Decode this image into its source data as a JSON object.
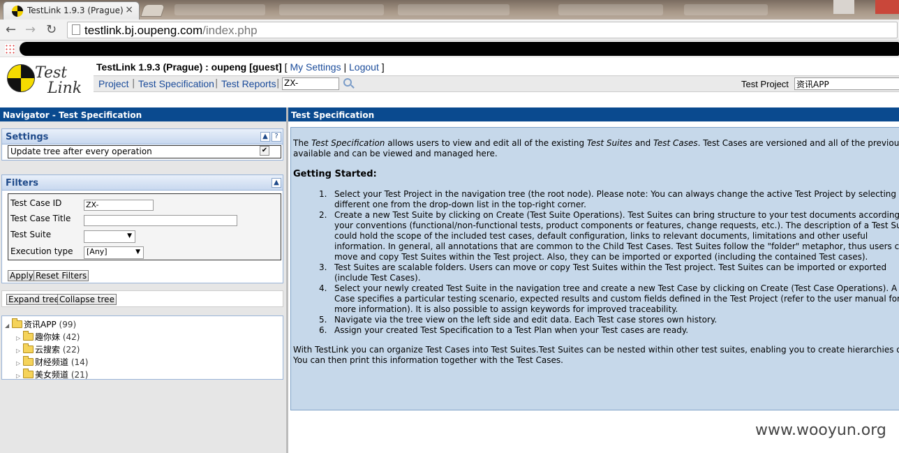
{
  "browser": {
    "tab_title": "TestLink 1.9.3 (Prague)",
    "tab_close": "×",
    "url_host": "testlink.bj.oupeng.com",
    "url_path": "/index.php"
  },
  "header": {
    "logo_text_1": "Test",
    "logo_text_2": "Link",
    "title": "TestLink 1.9.3 (Prague) : oupeng [guest]",
    "bracket_open": " [ ",
    "my_settings": "My Settings",
    "pipe": " | ",
    "logout": "Logout",
    "bracket_close": " ]",
    "menu": {
      "project": "Project",
      "test_specification": "Test Specification",
      "test_reports": "Test Reports",
      "sep": "|",
      "tc_search_value": "ZX-"
    },
    "test_project_label": "Test Project",
    "test_project_value": "资讯APP"
  },
  "navigator": {
    "title": "Navigator - Test Specification",
    "settings": {
      "title": "Settings",
      "collapse": "▲",
      "help": "?",
      "update_tree_label": "Update tree after every operation",
      "update_tree_checked": "✔"
    },
    "filters": {
      "title": "Filters",
      "collapse": "▲",
      "test_case_id_label": "Test Case ID",
      "test_case_id_value": "ZX-",
      "test_case_title_label": "Test Case Title",
      "test_suite_label": "Test Suite",
      "execution_type_label": "Execution type",
      "execution_type_value": "[Any]",
      "arrow": "▼",
      "apply": "Apply",
      "reset": "Reset Filters"
    },
    "tree_buttons": {
      "expand": "Expand tree",
      "collapse": "Collapse tree"
    },
    "tree": {
      "root": {
        "label": "资讯APP",
        "count": "(99)"
      },
      "children": [
        {
          "label": "趣你妹",
          "count": "(42)"
        },
        {
          "label": "云搜索",
          "count": "(22)"
        },
        {
          "label": "财经频道",
          "count": "(14)"
        },
        {
          "label": "美女频道",
          "count": "(21)"
        }
      ]
    }
  },
  "content": {
    "pane_title": "Test Specification",
    "intro_1a": "The ",
    "intro_1b": "Test Specification",
    "intro_1c": " allows users to view and edit all of the existing ",
    "intro_1d": "Test Suites",
    "intro_1e": " and ",
    "intro_1f": "Test Cases",
    "intro_1g": ". Test Cases are versioned and all of the previous versions are",
    "intro_2": "available and can be viewed and managed here.",
    "getting_started": "Getting Started:",
    "steps": [
      {
        "num": "1.",
        "lines": [
          "Select your Test Project in the navigation tree (the root node). Please note: You can always change the active Test Project by selecting a",
          "different one from the drop-down list in the top-right corner."
        ]
      },
      {
        "num": "2.",
        "lines": [
          "Create a new Test Suite by clicking on Create (Test Suite Operations). Test Suites can bring structure to your test documents according to",
          "your conventions (functional/non-functional tests, product components or features, change requests, etc.). The description of a Test Suite",
          "could hold the scope of the included test cases, default configuration, links to relevant documents, limitations and other useful",
          "information. In general, all annotations that are common to the Child Test Cases. Test Suites follow the \"folder\" metaphor, thus users can",
          "move and copy Test Suites within the Test project. Also, they can be imported or exported (including the contained Test cases)."
        ]
      },
      {
        "num": "3.",
        "lines": [
          "Test Suites are scalable folders. Users can move or copy Test Suites within the Test project. Test Suites can be imported or exported",
          "(include Test Cases)."
        ]
      },
      {
        "num": "4.",
        "lines": [
          "Select your newly created Test Suite in the navigation tree and create a new Test Case by clicking on Create (Test Case Operations). A Test",
          "Case specifies a particular testing scenario, expected results and custom fields defined in the Test Project (refer to the user manual for",
          "more information). It is also possible to assign keywords for improved traceability."
        ]
      },
      {
        "num": "5.",
        "lines": [
          "Navigate via the tree view on the left side and edit data. Each Test case stores own history."
        ]
      },
      {
        "num": "6.",
        "lines": [
          "Assign your created Test Specification to a Test Plan when your Test cases are ready."
        ]
      }
    ],
    "outro_1": "With TestLink you can organize Test Cases into Test Suites.Test Suites can be nested within other test suites, enabling you to create hierarchies of Test Suites.",
    "outro_2": "You can then print this information together with the Test Cases."
  },
  "watermark": "www.wooyun.org"
}
